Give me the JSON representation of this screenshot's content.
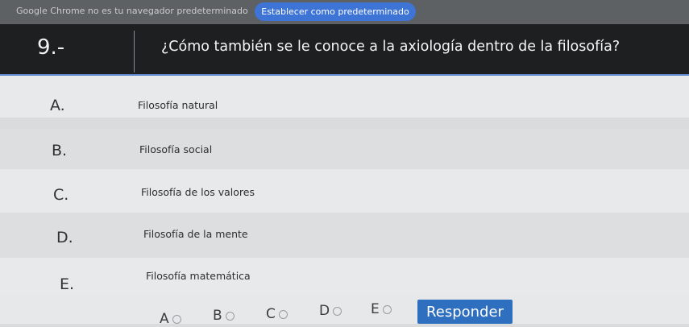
{
  "notification": {
    "message": "Google Chrome no es tu navegador predeterminado",
    "button_label": "Establecer como predeterminado"
  },
  "question": {
    "number": "9.-",
    "text": "¿Cómo también se le conoce a la axiología dentro de la filosofía?"
  },
  "options": [
    {
      "letter": "A.",
      "label": "Filosofía natural"
    },
    {
      "letter": "B.",
      "label": "Filosofía social"
    },
    {
      "letter": "C.",
      "label": "Filosofía de los valores"
    },
    {
      "letter": "D.",
      "label": "Filosofía de la mente"
    },
    {
      "letter": "E.",
      "label": "Filosofía matemática"
    }
  ],
  "answer_choices": [
    "A",
    "B",
    "C",
    "D",
    "E"
  ],
  "respond_label": "Responder",
  "colors": {
    "header_bg": "#1d1f21",
    "accent_blue": "#2f6fc0",
    "notif_button": "#3e74d6"
  }
}
